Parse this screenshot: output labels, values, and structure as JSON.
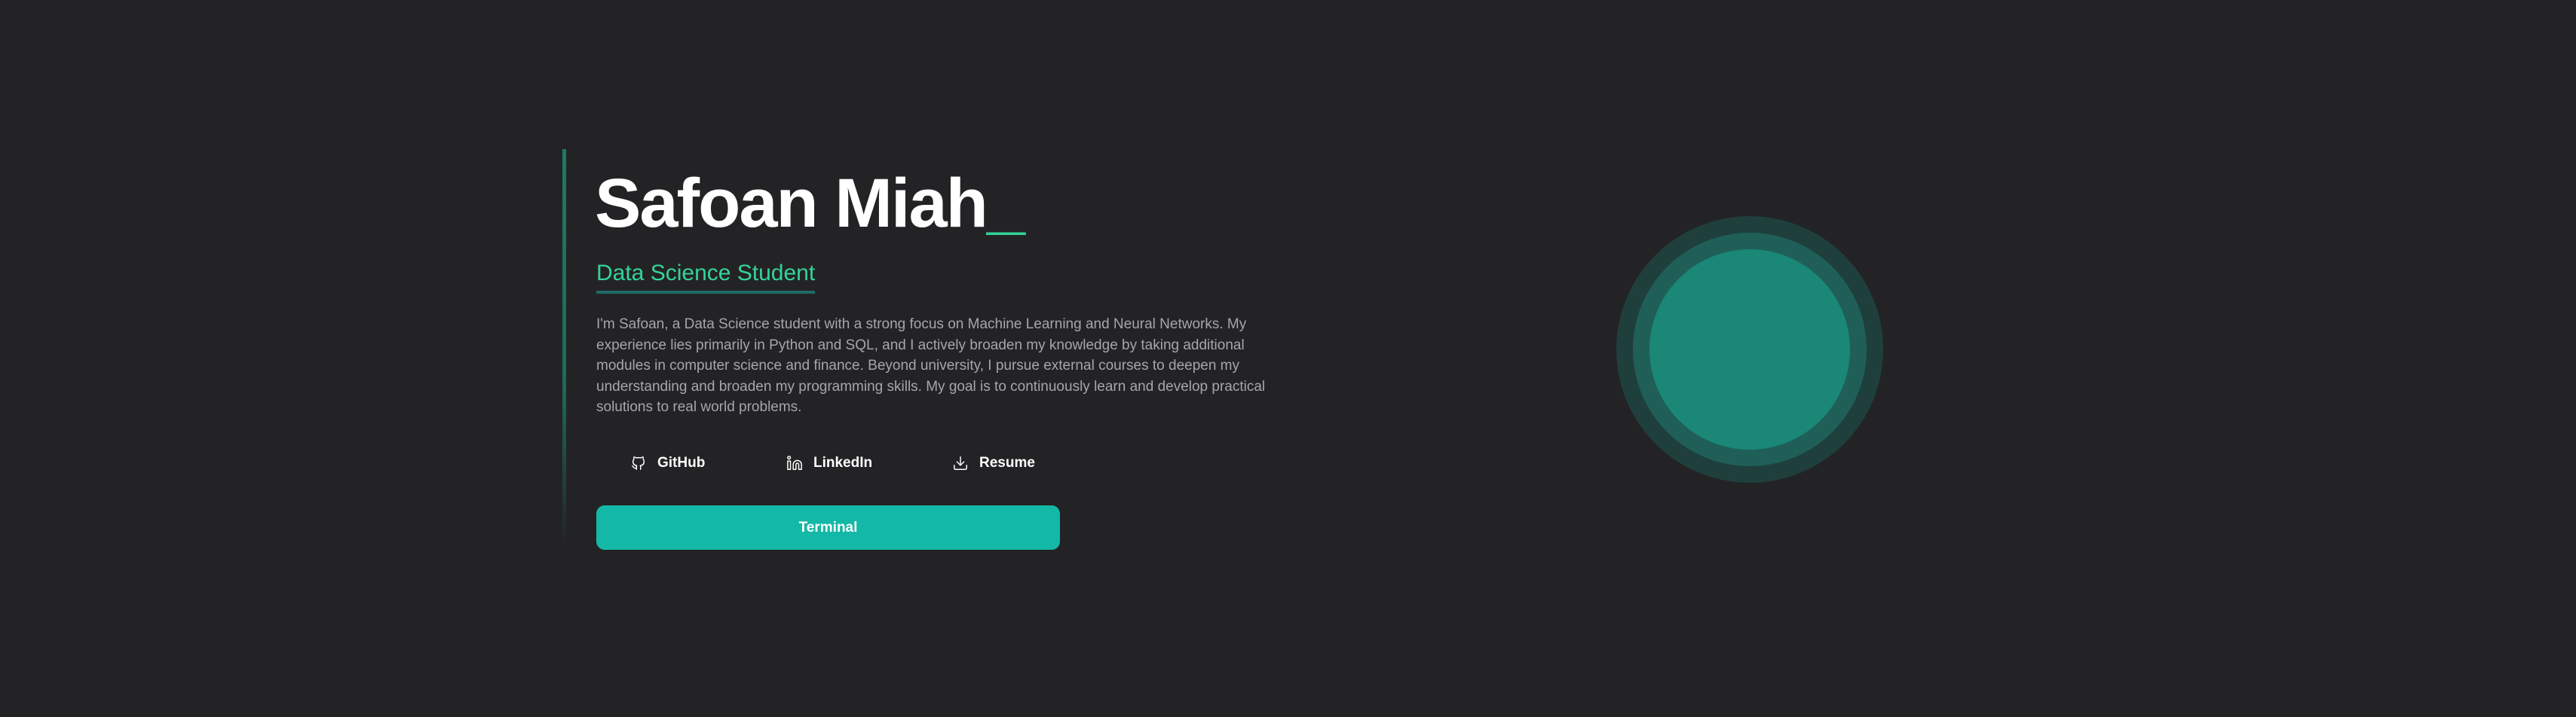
{
  "hero": {
    "name": "Safoan Miah",
    "cursor": "_",
    "role": "Data Science Student",
    "bio": "I'm Safoan, a Data Science student with a strong focus on Machine Learning and Neural Networks. My experience lies primarily in Python and SQL, and I actively broaden my knowledge by taking additional modules in computer science and finance. Beyond university, I pursue external courses to deepen my understanding and broaden my programming skills. My goal is to continuously learn and develop practical solutions to real world problems.",
    "links": [
      {
        "label": "GitHub",
        "icon": "github-icon"
      },
      {
        "label": "LinkedIn",
        "icon": "linkedin-icon"
      },
      {
        "label": "Resume",
        "icon": "download-icon"
      }
    ],
    "terminal_label": "Terminal"
  },
  "colors": {
    "background": "#232325",
    "accent": "#34d399",
    "button": "#14b8a6"
  }
}
